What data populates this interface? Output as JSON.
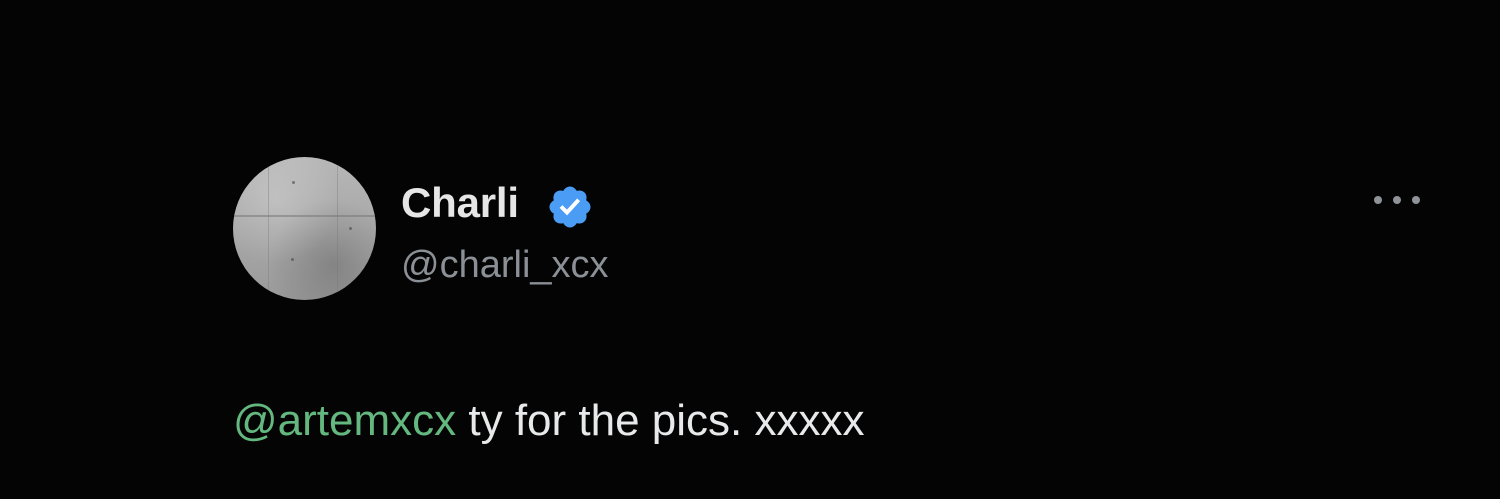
{
  "post": {
    "author": {
      "display_name": "Charli",
      "handle": "@charli_xcx",
      "verified": true,
      "verified_badge_icon": "verified-badge-icon",
      "avatar_icon": "avatar-image"
    },
    "menu": {
      "icon": "more-options-icon"
    },
    "content": {
      "mention": "@artemxcx",
      "text": " ty for the pics. xxxxx"
    }
  },
  "colors": {
    "background": "#040404",
    "name": "#e6e6e6",
    "handle": "#8b9096",
    "mention": "#63b77f",
    "verified": "#4a9cf5"
  }
}
